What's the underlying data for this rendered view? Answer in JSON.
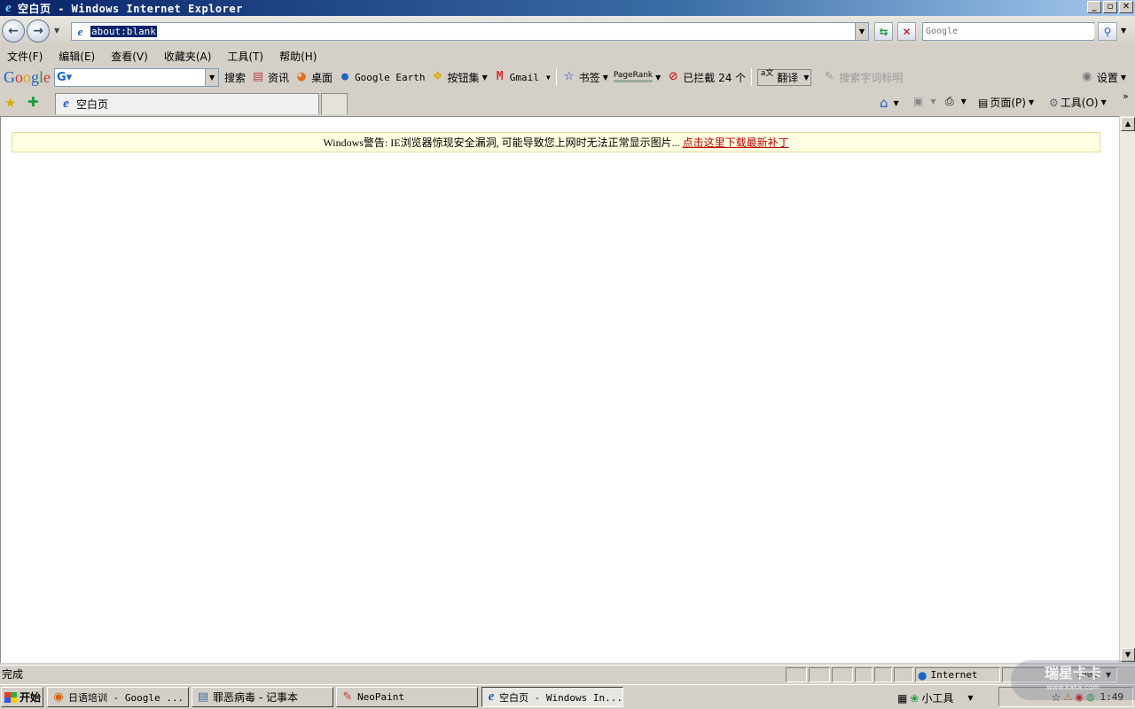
{
  "window": {
    "title": "空白页 - Windows Internet Explorer",
    "btn_min": "_",
    "btn_max": "▫",
    "btn_close": "✕"
  },
  "nav": {
    "address": "about:blank",
    "search_placeholder": "Google"
  },
  "menu": [
    "文件(F)",
    "编辑(E)",
    "查看(V)",
    "收藏夹(A)",
    "工具(T)",
    "帮助(H)"
  ],
  "google_toolbar": {
    "search_btn": "搜索",
    "news": "资讯",
    "desktop": "桌面",
    "earth": "Google Earth",
    "buttons": "按钮集",
    "gmail": "Gmail",
    "bookmarks": "书签",
    "pagerank": "PageRank",
    "blocked": "已拦截 24 个",
    "translate": "翻译",
    "highlight": "搜索字词标明",
    "settings": "设置"
  },
  "tabs": [
    {
      "label": "空白页"
    }
  ],
  "commandbar": {
    "page": "页面(P)",
    "tools": "工具(O)"
  },
  "warning": {
    "text": "Windows警告: IE浏览器惊现安全漏洞, 可能导致您上网时无法正常显示图片... ",
    "link": "点击这里下载最新补丁"
  },
  "status": {
    "text": "完成",
    "zone": "Internet",
    "zoom": "100%"
  },
  "taskbar": {
    "start": "开始",
    "items": [
      {
        "label": "日语培训 - Google ..."
      },
      {
        "label": "罪恶病毒 - 记事本"
      },
      {
        "label": "NeoPaint"
      },
      {
        "label": "空白页 - Windows In..."
      }
    ],
    "gadget": "小工具",
    "clock": "1:49"
  },
  "watermark": {
    "line1": "瑞星卡卡",
    "line2": "www.kaka.com"
  }
}
